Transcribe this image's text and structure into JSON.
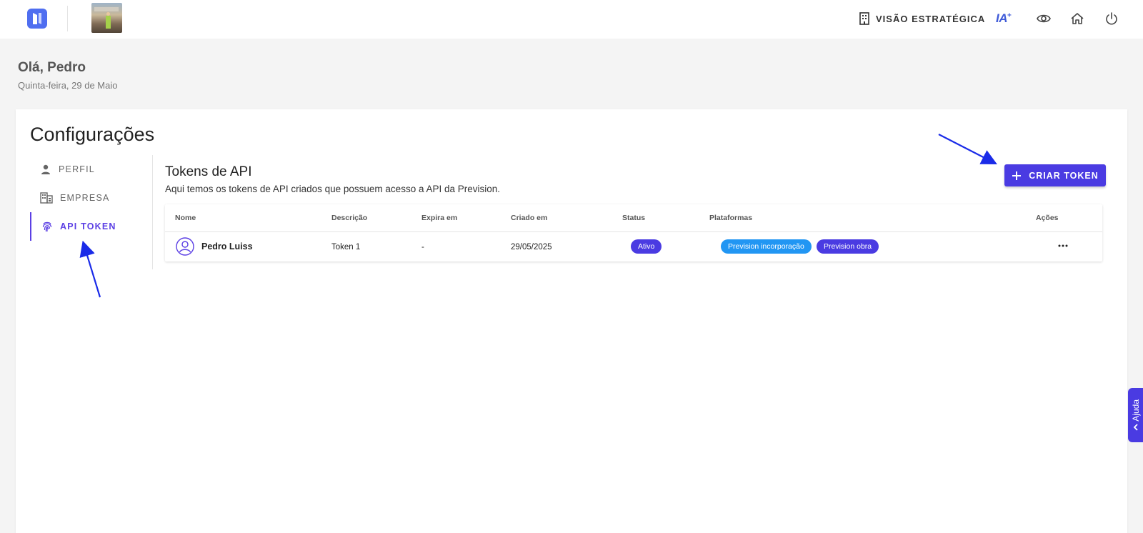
{
  "topbar": {
    "visao_label": "VISÃO ESTRATÉGICA",
    "ia_label": "IA",
    "ia_sup": "+"
  },
  "greeting": {
    "title": "Olá, Pedro",
    "date": "Quinta-feira, 29 de Maio"
  },
  "settings": {
    "title": "Configurações",
    "menu": [
      {
        "label": "PERFIL",
        "icon": "person-icon",
        "active": false
      },
      {
        "label": "EMPRESA",
        "icon": "building-icon",
        "active": false
      },
      {
        "label": "API TOKEN",
        "icon": "fingerprint-icon",
        "active": true
      }
    ]
  },
  "tokens": {
    "title": "Tokens de API",
    "subtitle": "Aqui temos os tokens de API criados que possuem acesso a API da Prevision.",
    "create_button": "CRIAR TOKEN",
    "columns": [
      "Nome",
      "Descrição",
      "Expira em",
      "Criado em",
      "Status",
      "Plataformas",
      "Ações"
    ],
    "rows": [
      {
        "name": "Pedro Luiss",
        "description": "Token 1",
        "expires": "-",
        "created": "29/05/2025",
        "status": "Ativo",
        "platforms": [
          "Prevision incorporação",
          "Prevision obra"
        ]
      }
    ]
  },
  "help": {
    "label": "Ajuda"
  },
  "colors": {
    "accent": "#4a3be2",
    "chip_blue": "#2196f3",
    "annotation": "#1a2be8"
  }
}
